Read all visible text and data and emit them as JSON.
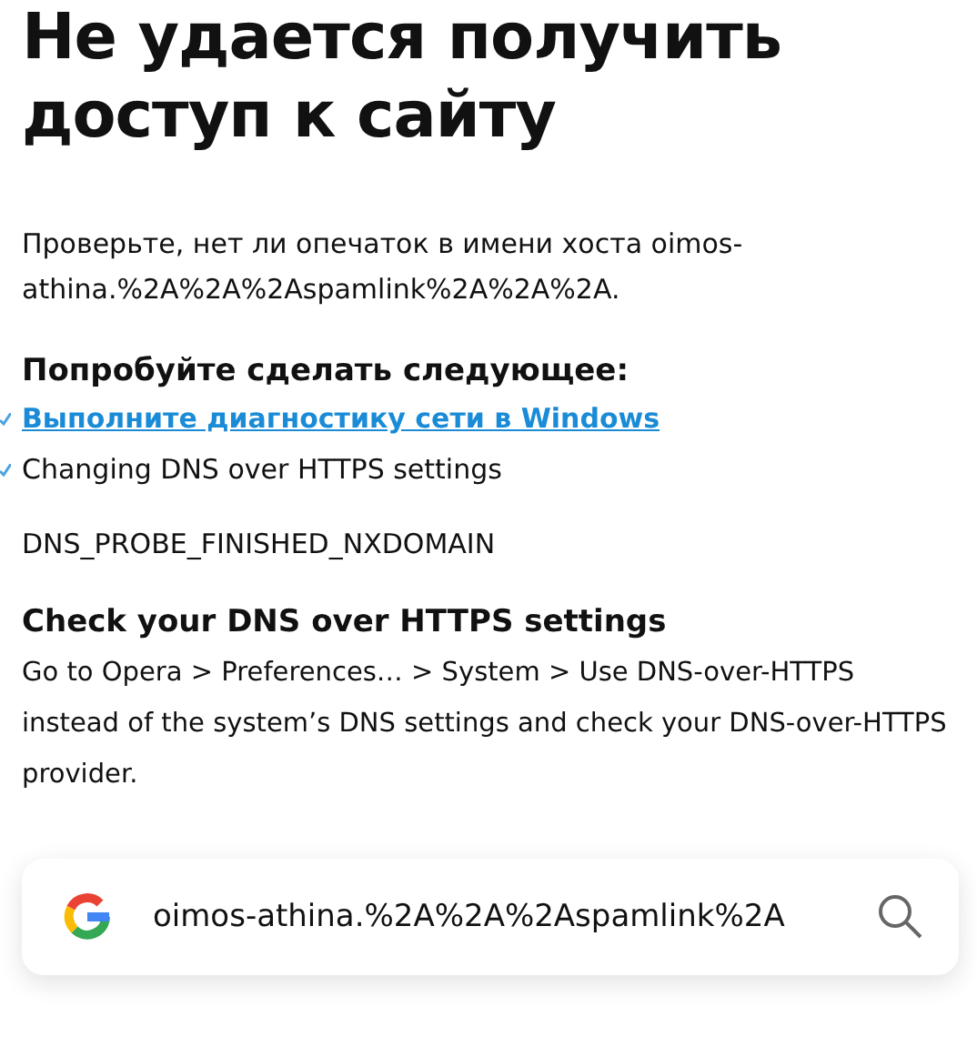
{
  "title": "Не удается получить доступ к сайту",
  "message": "Проверьте, нет ли опечаток в имени хоста oimos-athina.%2A%2A%2Aspamlink%2A%2A%2A.",
  "suggestions": {
    "heading": "Попробуйте сделать следующее:",
    "items": [
      {
        "kind": "link",
        "text": "Выполните диагностику сети в Windows"
      },
      {
        "kind": "text",
        "text": "Changing DNS over HTTPS settings"
      }
    ]
  },
  "error_code": "DNS_PROBE_FINISHED_NXDOMAIN",
  "dns_section": {
    "heading": "Check your DNS over HTTPS settings",
    "body": "Go to Opera > Preferences… > System > Use DNS-over-HTTPS instead of the system’s DNS settings and check your DNS-over-HTTPS provider."
  },
  "search": {
    "value": "oimos-athina.%2A%2A%2Aspamlink%2A"
  }
}
